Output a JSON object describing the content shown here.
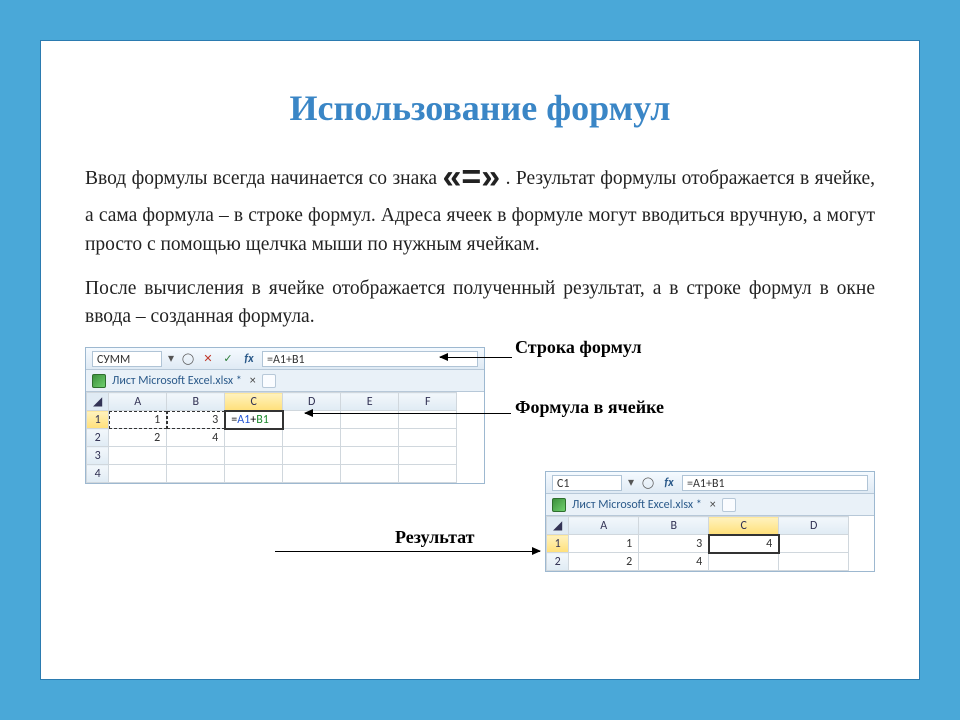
{
  "title": "Использование формул",
  "eq_sign": "«=»",
  "para1_a": "Ввод формулы всегда начинается со знака ",
  "para1_b": ". Результат формулы отображается в ячейке, а сама формула – в строке формул. Адреса ячеек в формуле могут вводиться вручную, а могут просто с помощью щелчка мыши по нужным ячейкам.",
  "para2": "После вычисления в ячейке отображается полученный результат, а в строке формул в окне ввода – созданная формула.",
  "callouts": {
    "formula_bar": "Строка формул",
    "cell_formula": "Формула в ячейке",
    "result": "Результат"
  },
  "excel1": {
    "namebox": "СУММ",
    "formula": "=A1+B1",
    "tabname": "Лист Microsoft Excel.xlsx *",
    "columns": [
      "A",
      "B",
      "C",
      "D",
      "E",
      "F"
    ],
    "rows": [
      {
        "n": 1,
        "cells": [
          "1",
          "3",
          "=A1+B1",
          "",
          "",
          ""
        ]
      },
      {
        "n": 2,
        "cells": [
          "2",
          "4",
          "",
          "",
          "",
          ""
        ]
      },
      {
        "n": 3,
        "cells": [
          "",
          "",
          "",
          "",
          "",
          ""
        ]
      },
      {
        "n": 4,
        "cells": [
          "",
          "",
          "",
          "",
          "",
          ""
        ]
      }
    ],
    "active_col": "C",
    "active_row": 1
  },
  "excel2": {
    "namebox": "C1",
    "formula": "=A1+B1",
    "tabname": "Лист Microsoft Excel.xlsx *",
    "columns": [
      "A",
      "B",
      "C",
      "D"
    ],
    "rows": [
      {
        "n": 1,
        "cells": [
          "1",
          "3",
          "4",
          ""
        ]
      },
      {
        "n": 2,
        "cells": [
          "2",
          "4",
          "",
          ""
        ]
      }
    ],
    "active_col": "C",
    "active_row": 1,
    "result_value": "4"
  }
}
